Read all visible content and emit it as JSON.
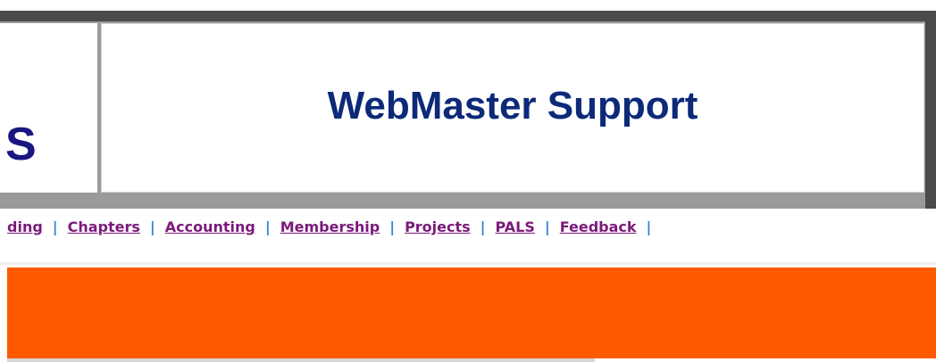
{
  "header": {
    "logo_partial_text": "S",
    "title": "WebMaster Support"
  },
  "nav": {
    "items": [
      {
        "label": "ding"
      },
      {
        "label": "Chapters"
      },
      {
        "label": "Accounting"
      },
      {
        "label": "Membership"
      },
      {
        "label": "Projects"
      },
      {
        "label": "PALS"
      },
      {
        "label": "Feedback"
      }
    ],
    "separator": "|"
  },
  "colors": {
    "title": "#0d2a78",
    "logo": "#1a1680",
    "nav_link": "#7a1a7a",
    "separator": "#3b7fd6",
    "band": "#ff5a00"
  }
}
